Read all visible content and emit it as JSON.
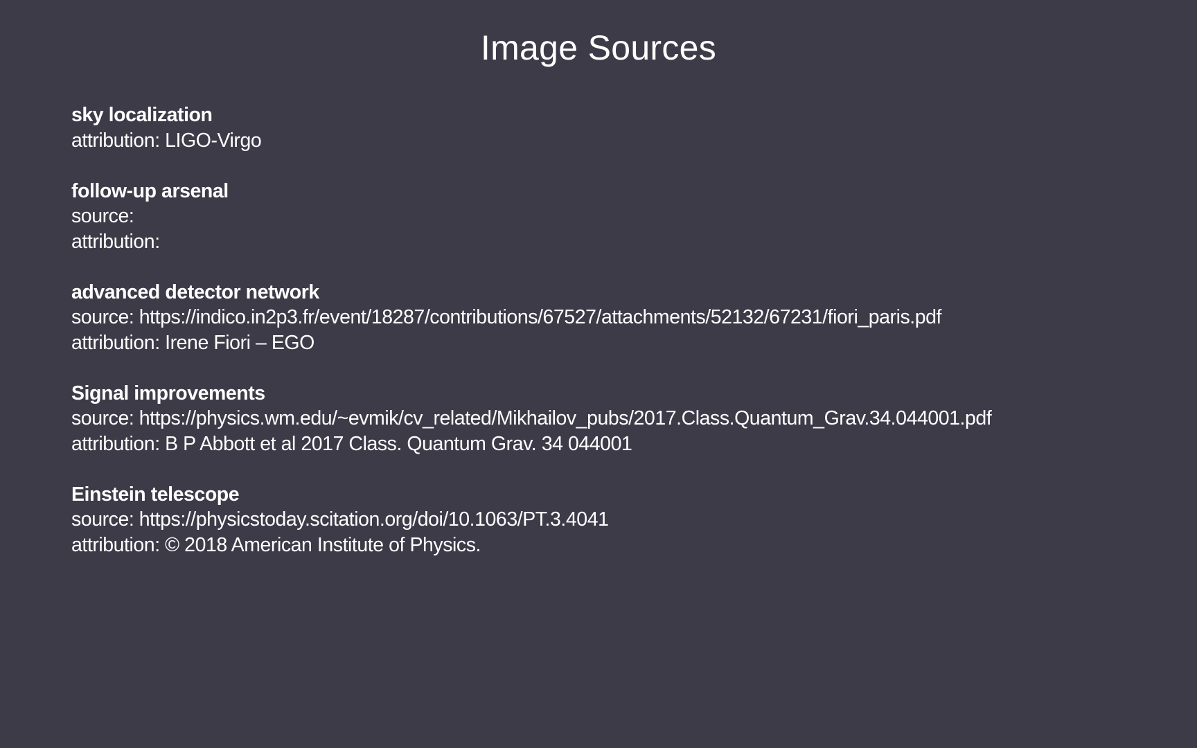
{
  "slide": {
    "title": "Image Sources",
    "entries": [
      {
        "heading": "sky localization",
        "lines": [
          "attribution: LIGO-Virgo"
        ]
      },
      {
        "heading": "follow-up arsenal",
        "lines": [
          "source:",
          "attribution:"
        ]
      },
      {
        "heading": "advanced detector network",
        "lines": [
          "source: https://indico.in2p3.fr/event/18287/contributions/67527/attachments/52132/67231/fiori_paris.pdf",
          "attribution: Irene Fiori – EGO"
        ]
      },
      {
        "heading": "Signal improvements",
        "lines": [
          "source: https://physics.wm.edu/~evmik/cv_related/Mikhailov_pubs/2017.Class.Quantum_Grav.34.044001.pdf",
          "attribution: B P Abbott et al 2017 Class. Quantum Grav. 34 044001"
        ]
      },
      {
        "heading": "Einstein telescope",
        "lines": [
          "source: https://physicstoday.scitation.org/doi/10.1063/PT.3.4041",
          "attribution: © 2018 American Institute of Physics."
        ]
      }
    ]
  },
  "colors": {
    "background": "#3d3b48",
    "text": "#ffffff"
  }
}
